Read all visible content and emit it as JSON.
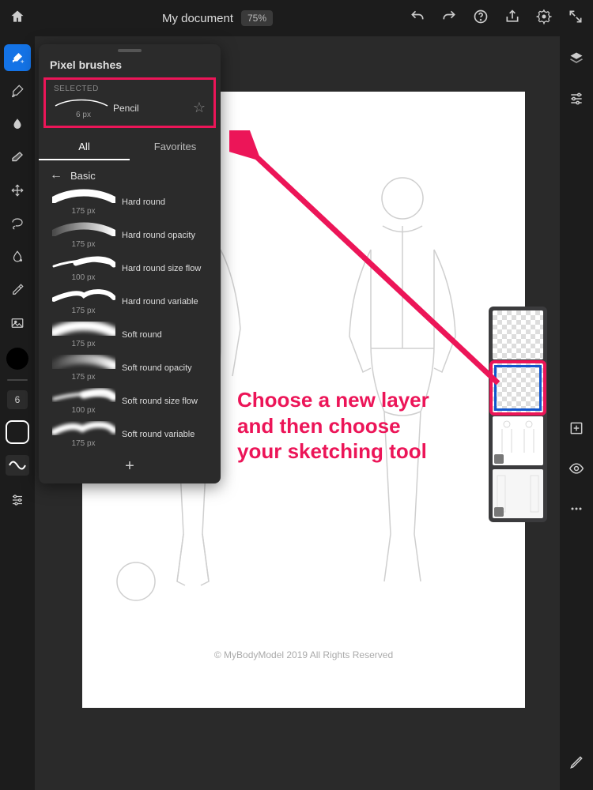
{
  "topbar": {
    "doc_title": "My document",
    "zoom": "75%"
  },
  "left_tools": {
    "size_value": "6"
  },
  "brush_panel": {
    "title": "Pixel brushes",
    "selected_label": "SELECTED",
    "selected_name": "Pencil",
    "selected_size": "6 px",
    "tab_all": "All",
    "tab_favorites": "Favorites",
    "category": "Basic",
    "brushes": [
      {
        "name": "Hard round",
        "size": "175 px",
        "kind": "hard"
      },
      {
        "name": "Hard round opacity",
        "size": "175 px",
        "kind": "hard-op"
      },
      {
        "name": "Hard round size flow",
        "size": "100 px",
        "kind": "hard-flow"
      },
      {
        "name": "Hard round variable",
        "size": "175 px",
        "kind": "hard-var"
      },
      {
        "name": "Soft round",
        "size": "175 px",
        "kind": "soft"
      },
      {
        "name": "Soft round opacity",
        "size": "175 px",
        "kind": "soft-op"
      },
      {
        "name": "Soft round size flow",
        "size": "100 px",
        "kind": "soft-flow"
      },
      {
        "name": "Soft round variable",
        "size": "175 px",
        "kind": "soft-var"
      }
    ]
  },
  "canvas": {
    "copyright": "© MyBodyModel 2019 All Rights Reserved"
  },
  "annotation": {
    "text_line1": "Choose a new layer",
    "text_line2": "and then choose",
    "text_line3": "your sketching tool"
  }
}
